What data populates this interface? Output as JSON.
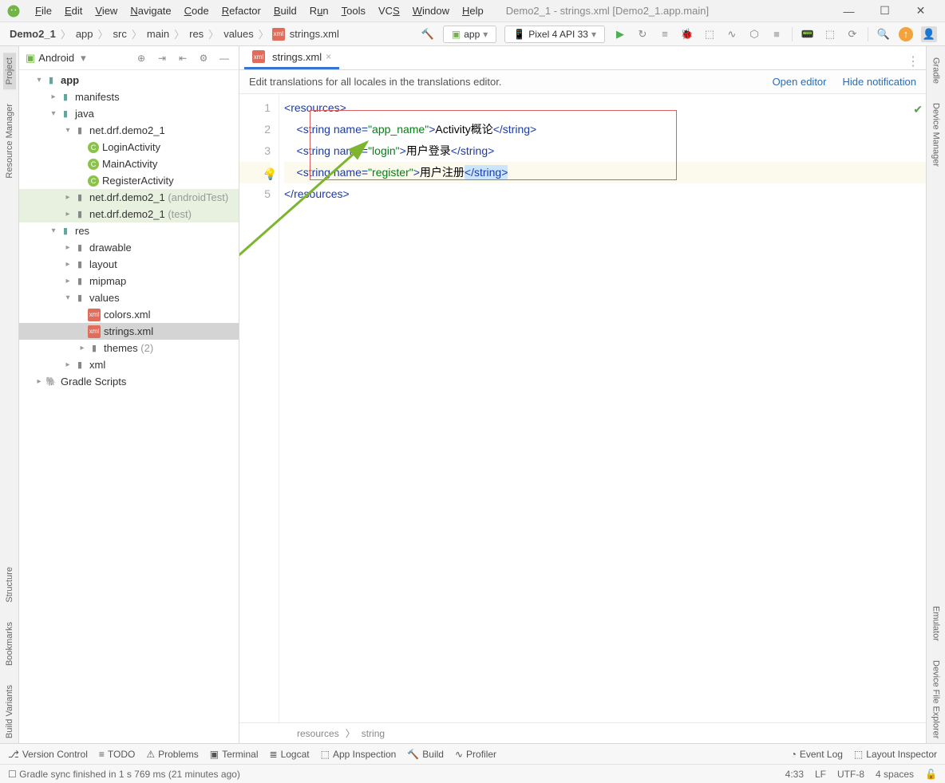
{
  "window": {
    "title": "Demo2_1 - strings.xml [Demo2_1.app.main]"
  },
  "menu": {
    "file": "File",
    "edit": "Edit",
    "view": "View",
    "navigate": "Navigate",
    "code": "Code",
    "refactor": "Refactor",
    "build": "Build",
    "run": "Run",
    "tools": "Tools",
    "vcs": "VCS",
    "window": "Window",
    "help": "Help"
  },
  "breadcrumbs": [
    "Demo2_1",
    "app",
    "src",
    "main",
    "res",
    "values",
    "strings.xml"
  ],
  "run_config": {
    "module": "app",
    "device": "Pixel 4 API 33"
  },
  "project_selector": "Android",
  "tree": {
    "app": "app",
    "manifests": "manifests",
    "java": "java",
    "pkg": "net.drf.demo2_1",
    "login": "LoginActivity",
    "main": "MainActivity",
    "register": "RegisterActivity",
    "pkg_at": "net.drf.demo2_1",
    "at_suffix": "(androidTest)",
    "pkg_test": "net.drf.demo2_1",
    "test_suffix": "(test)",
    "res": "res",
    "drawable": "drawable",
    "layout": "layout",
    "mipmap": "mipmap",
    "values": "values",
    "colors": "colors.xml",
    "strings": "strings.xml",
    "themes": "themes",
    "themes_count": "(2)",
    "xml": "xml",
    "gradle": "Gradle Scripts"
  },
  "tab": {
    "name": "strings.xml"
  },
  "banner": {
    "text": "Edit translations for all locales in the translations editor.",
    "open": "Open editor",
    "hide": "Hide notification"
  },
  "code": {
    "l1": {
      "p": "<",
      "t": "resources",
      "e": ">"
    },
    "l2": {
      "i": "    <",
      "t": "string ",
      "a": "name",
      "q": "=",
      "v": "\"app_name\"",
      "c": ">",
      "txt": "Activity概论",
      "ce": "</",
      "te": "string",
      "ee": ">"
    },
    "l3": {
      "i": "    <",
      "t": "string ",
      "a": "name",
      "q": "=",
      "v": "\"login\"",
      "c": ">",
      "txt": "用户登录",
      "ce": "</",
      "te": "string",
      "ee": ">"
    },
    "l4": {
      "i": "    <",
      "t": "string ",
      "a": "name",
      "q": "=",
      "v": "\"register\"",
      "c": ">",
      "txt": "用户注册",
      "ce": "</",
      "te": "string",
      "ee": ">"
    },
    "l5": {
      "p": "</",
      "t": "resources",
      "e": ">"
    }
  },
  "footer_crumb": {
    "a": "resources",
    "b": "string"
  },
  "bottom": {
    "vc": "Version Control",
    "todo": "TODO",
    "problems": "Problems",
    "terminal": "Terminal",
    "logcat": "Logcat",
    "inspect": "App Inspection",
    "build": "Build",
    "profiler": "Profiler",
    "eventlog": "Event Log",
    "layoutinsp": "Layout Inspector"
  },
  "status": {
    "msg": "Gradle sync finished in 1 s 769 ms (21 minutes ago)",
    "pos": "4:33",
    "sep": "LF",
    "enc": "UTF-8",
    "indent": "4 spaces"
  },
  "left_tabs": {
    "project": "Project",
    "rm": "Resource Manager",
    "structure": "Structure",
    "bookmarks": "Bookmarks",
    "variants": "Build Variants"
  },
  "right_tabs": {
    "gradle": "Gradle",
    "devmgr": "Device Manager",
    "emulator": "Emulator",
    "explorer": "Device File Explorer"
  }
}
